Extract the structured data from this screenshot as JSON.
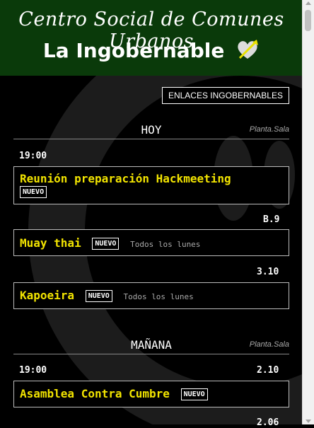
{
  "header": {
    "subtitle": "Centro Social de Comunes Urbanos",
    "title": "La Ingobernable"
  },
  "links_button": "ENLACES INGOBERNABLES",
  "days": [
    {
      "label": "HOY",
      "column_label": "Planta.Sala",
      "time": "19:00",
      "events": [
        {
          "name": "Reunión preparación Hackmeeting",
          "badge": "NUEVO",
          "note": "",
          "room": ""
        },
        {
          "name": "Muay thai",
          "badge": "NUEVO",
          "note": "Todos los lunes",
          "room": "B.9"
        },
        {
          "name": "Kapoeira",
          "badge": "NUEVO",
          "note": "Todos los lunes",
          "room": "3.10"
        }
      ]
    },
    {
      "label": "MAÑANA",
      "column_label": "Planta.Sala",
      "time": "19:00",
      "events": [
        {
          "name": "Asamblea Contra Cumbre",
          "badge": "NUEVO",
          "note": "",
          "room": "2.10"
        }
      ],
      "next_room": "2.06"
    }
  ],
  "colors": {
    "header_bg": "#0a3a0a",
    "event_title": "#f2e400",
    "background": "#000000"
  }
}
